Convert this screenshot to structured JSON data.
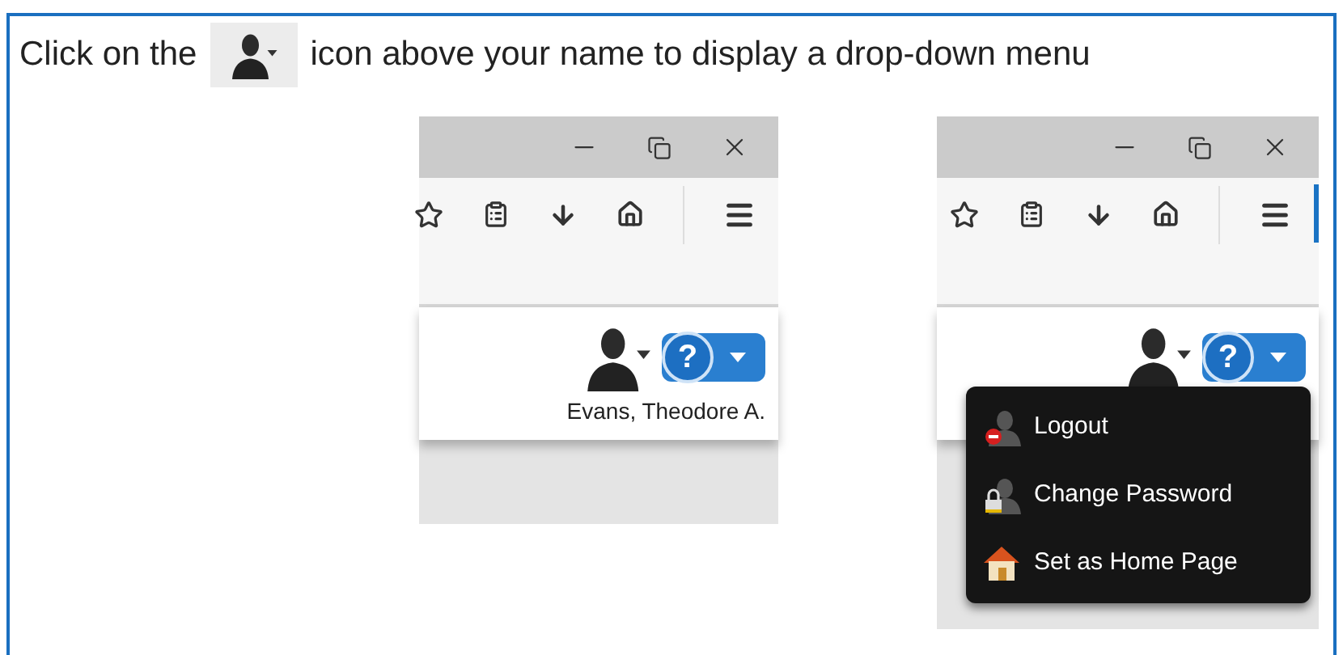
{
  "instruction": {
    "before": "Click on the",
    "after": "icon above your name to display a drop-down menu"
  },
  "screenshots": [
    {
      "help_label": "?",
      "user_name": "Evans, Theodore A."
    },
    {
      "help_label": "?",
      "menu": {
        "items": [
          {
            "label": "Logout",
            "kind": "logout"
          },
          {
            "label": "Change Password",
            "kind": "password"
          },
          {
            "label": "Set as Home Page",
            "kind": "home"
          }
        ]
      }
    }
  ]
}
